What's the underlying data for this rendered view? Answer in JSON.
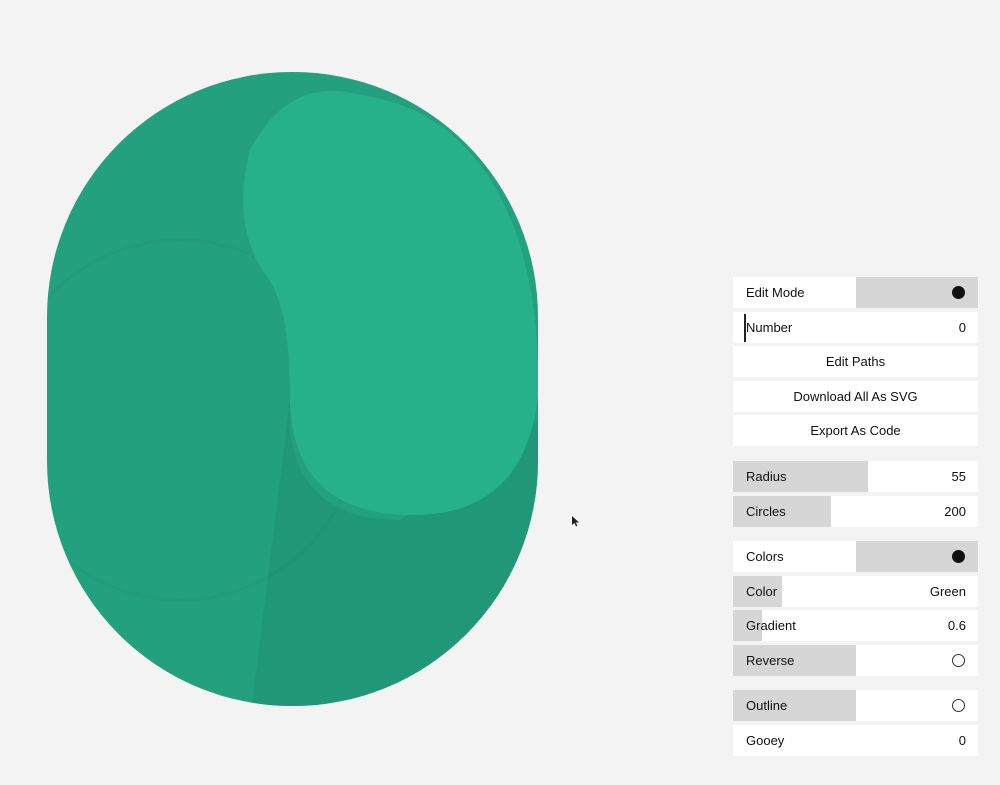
{
  "colors": {
    "base": "#23a07e",
    "highlight": "#27b18b",
    "shadow": "#1f8f71",
    "background": "#f2f3f2"
  },
  "panel": {
    "edit_mode": {
      "label": "Edit Mode",
      "enabled": true
    },
    "number": {
      "label": "Number",
      "value": "0"
    },
    "edit_paths": {
      "label": "Edit Paths"
    },
    "download_svg": {
      "label": "Download All As SVG"
    },
    "export_code": {
      "label": "Export As Code"
    },
    "radius": {
      "label": "Radius",
      "value": "55",
      "level": 0.55
    },
    "circles": {
      "label": "Circles",
      "value": "200",
      "level": 0.4
    },
    "colors": {
      "label": "Colors",
      "enabled": true
    },
    "color": {
      "label": "Color",
      "value": "Green",
      "level": 0.2
    },
    "gradient": {
      "label": "Gradient",
      "value": "0.6",
      "level": 0.12
    },
    "reverse": {
      "label": "Reverse",
      "enabled": false
    },
    "outline": {
      "label": "Outline",
      "enabled": false
    },
    "gooey": {
      "label": "Gooey",
      "value": "0"
    }
  }
}
